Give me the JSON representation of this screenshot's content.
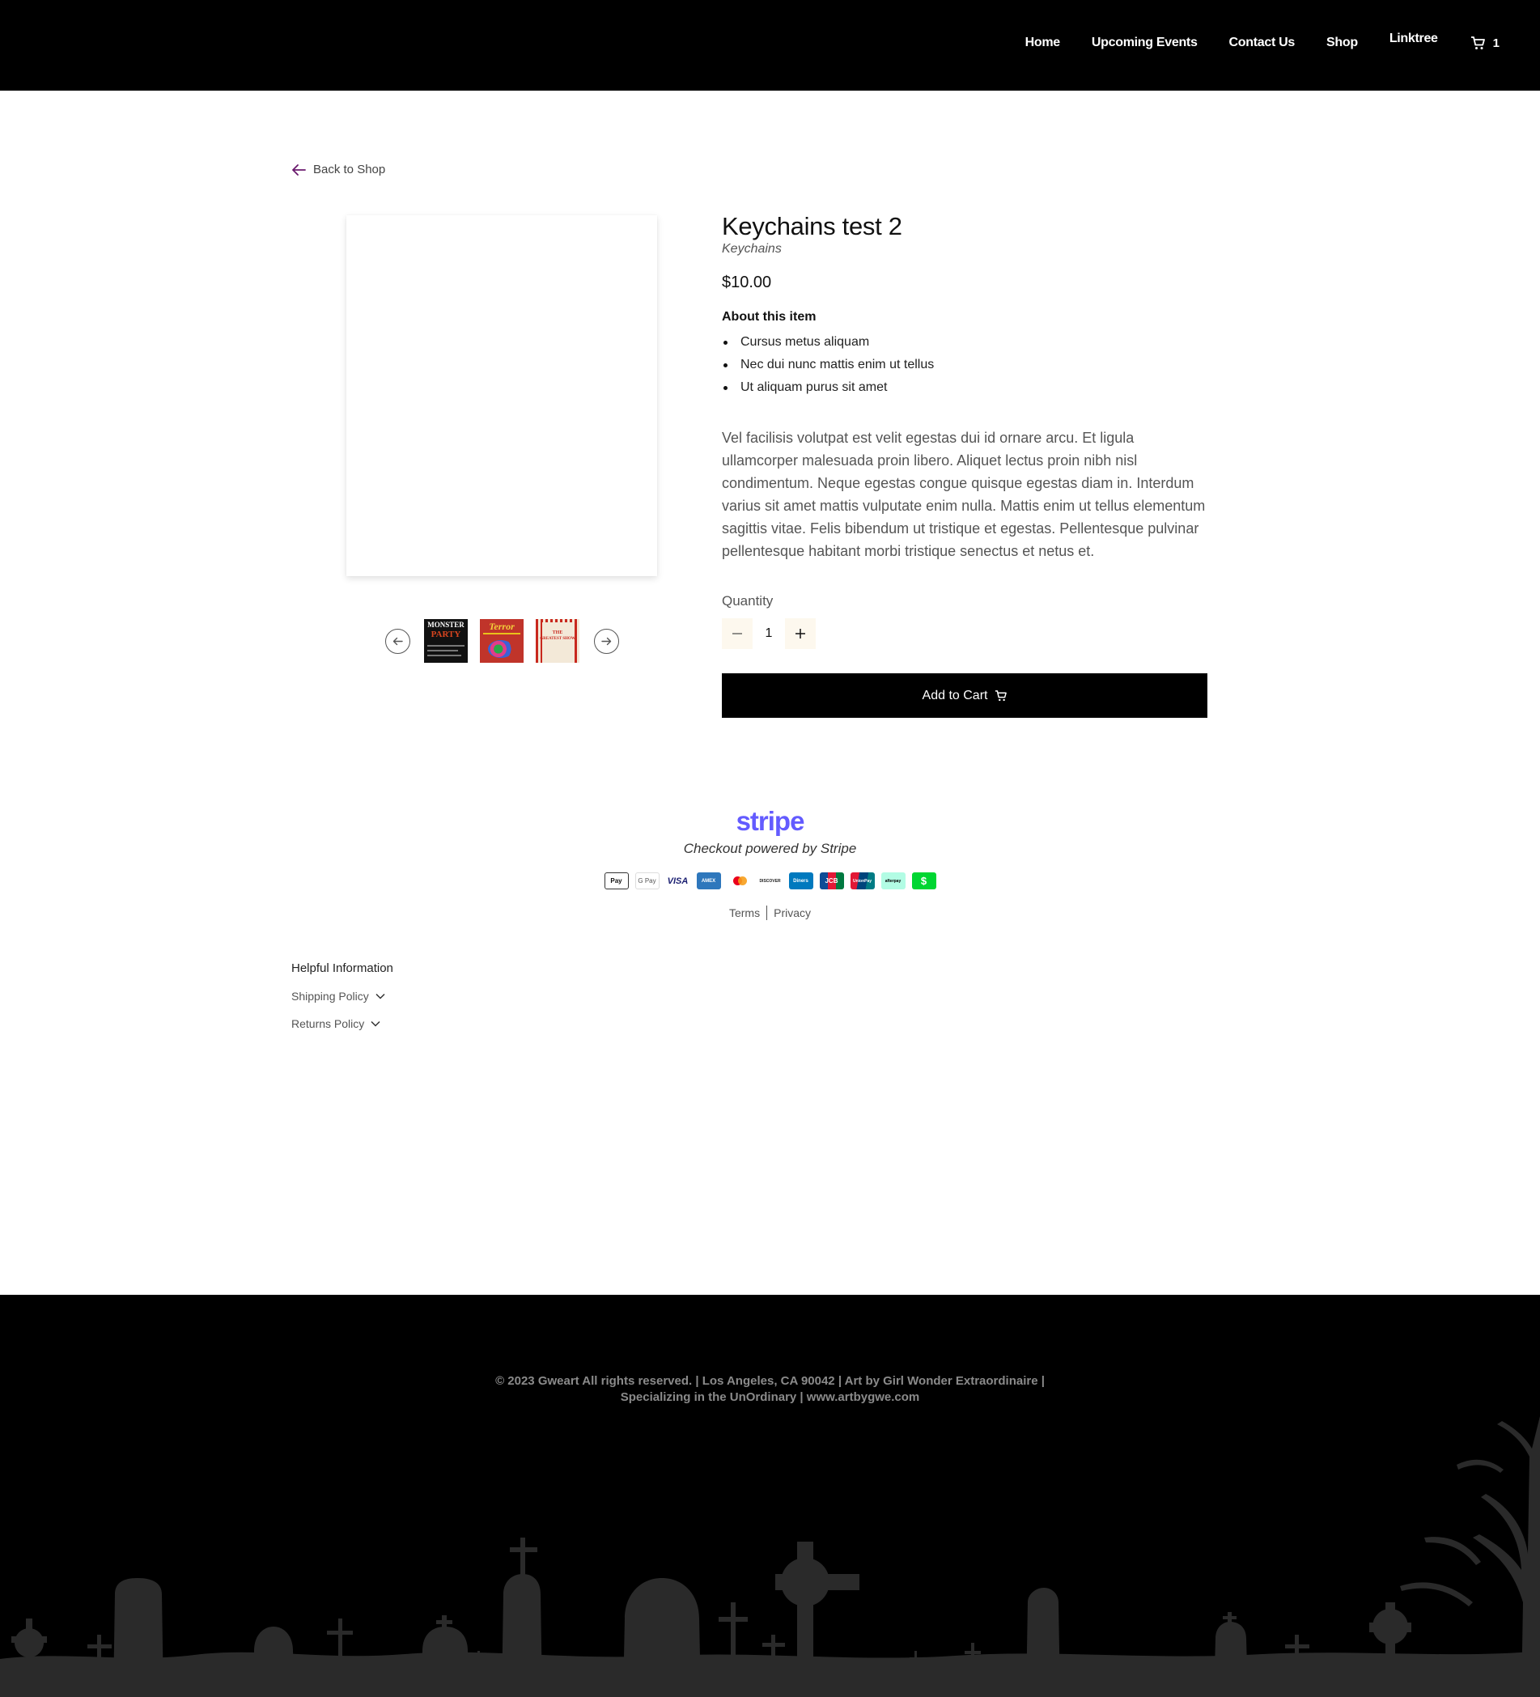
{
  "nav": {
    "items": [
      {
        "label": "Home"
      },
      {
        "label": "Upcoming Events"
      },
      {
        "label": "Contact Us"
      },
      {
        "label": "Shop"
      },
      {
        "label": "Linktree"
      }
    ],
    "cart_count": "1"
  },
  "back_link": "Back to Shop",
  "product": {
    "title": "Keychains test 2",
    "category": "Keychains",
    "price": "$10.00",
    "about_title": "About this item",
    "bullets": [
      "Cursus metus aliquam",
      "Nec dui nunc mattis enim ut tellus",
      "Ut aliquam purus sit amet"
    ],
    "description": "Vel facilisis volutpat est velit egestas dui id ornare arcu. Et ligula ullamcorper malesuada proin libero. Aliquet lectus proin nibh nisl condimentum. Neque egestas congue quisque egestas diam in. Interdum varius sit amet mattis vulputate enim nulla. Mattis enim ut tellus elementum sagittis vitae. Felis bibendum ut tristique et egestas. Pellentesque pulvinar pellentesque habitant morbi tristique senectus et netus et.",
    "quantity_label": "Quantity",
    "quantity": "1",
    "add_to_cart": "Add to Cart",
    "thumbnails": [
      {
        "text_1": "MONSTER",
        "text_2": "PARTY",
        "colors": [
          "#111111",
          "#d9451f"
        ]
      },
      {
        "text_1": "Terror",
        "text_2": "",
        "colors": [
          "#c0342a",
          "#e8c21a"
        ]
      },
      {
        "text_1": "THE",
        "text_2": "GREATEST SHOW",
        "colors": [
          "#f3e9d8",
          "#c8281e"
        ]
      }
    ]
  },
  "stripe": {
    "logo": "stripe",
    "subtitle": "Checkout powered by Stripe",
    "payment_methods": [
      "Pay",
      "G Pay",
      "VISA",
      "AMEX",
      "mastercard",
      "DISCOVER",
      "Diners",
      "JCB",
      "UnionPay",
      "afterpay",
      "$"
    ],
    "terms": "Terms",
    "privacy": "Privacy"
  },
  "helpful": {
    "title": "Helpful Information",
    "items": [
      "Shipping Policy",
      "Returns Policy"
    ]
  },
  "footer": {
    "line1": "© 2023 Gweart All rights reserved. | Los Angeles, CA 90042 | Art by Girl Wonder Extraordinaire |",
    "line2": "Specializing in the UnOrdinary | www.artbygwe.com"
  }
}
